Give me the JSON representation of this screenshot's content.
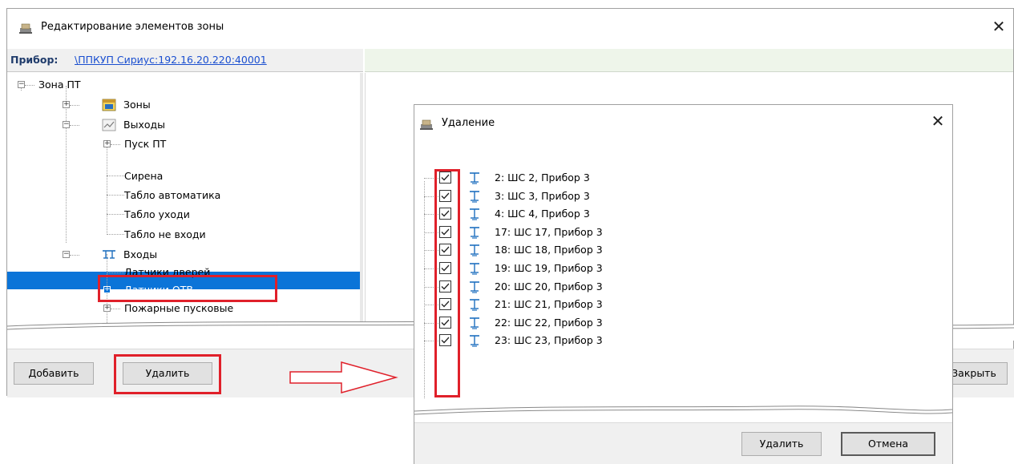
{
  "main_window": {
    "title": "Редактирование элементов зоны",
    "close_glyph": "✕",
    "device_label": "Прибор:",
    "device_link": "\\ППКУП Сириус:192.16.20.220:40001",
    "tree": {
      "root": "Зона ПТ",
      "zones": "Зоны",
      "outputs": "Выходы",
      "output_items": [
        "Пуск ПТ",
        "Сирена",
        "Табло автоматика",
        "Табло уходи",
        "Табло не входи"
      ],
      "inputs": "Входы",
      "input_items": [
        "Датчики дверей",
        "Датчики ОТВ",
        "Пожарные пусковые"
      ]
    },
    "buttons": {
      "add": "Добавить",
      "delete": "Удалить",
      "close": "Закрыть"
    }
  },
  "dialog": {
    "title": "Удаление",
    "close_glyph": "✕",
    "items": [
      "2: ШС 2, Прибор 3",
      "3: ШС 3, Прибор 3",
      "4: ШС 4, Прибор 3",
      "17: ШС 17, Прибор 3",
      "18: ШС 18, Прибор 3",
      "19: ШС 19, Прибор 3",
      "20: ШС 20, Прибор 3",
      "21: ШС 21, Прибор 3",
      "22: ШС 22, Прибор 3",
      "23: ШС 23, Прибор 3"
    ],
    "buttons": {
      "delete": "Удалить",
      "cancel": "Отмена"
    }
  },
  "colors": {
    "selection": "#0b74d8",
    "highlight": "#e0202a",
    "link": "#1a4fd0",
    "zone_icon": "#1e6fbf"
  }
}
